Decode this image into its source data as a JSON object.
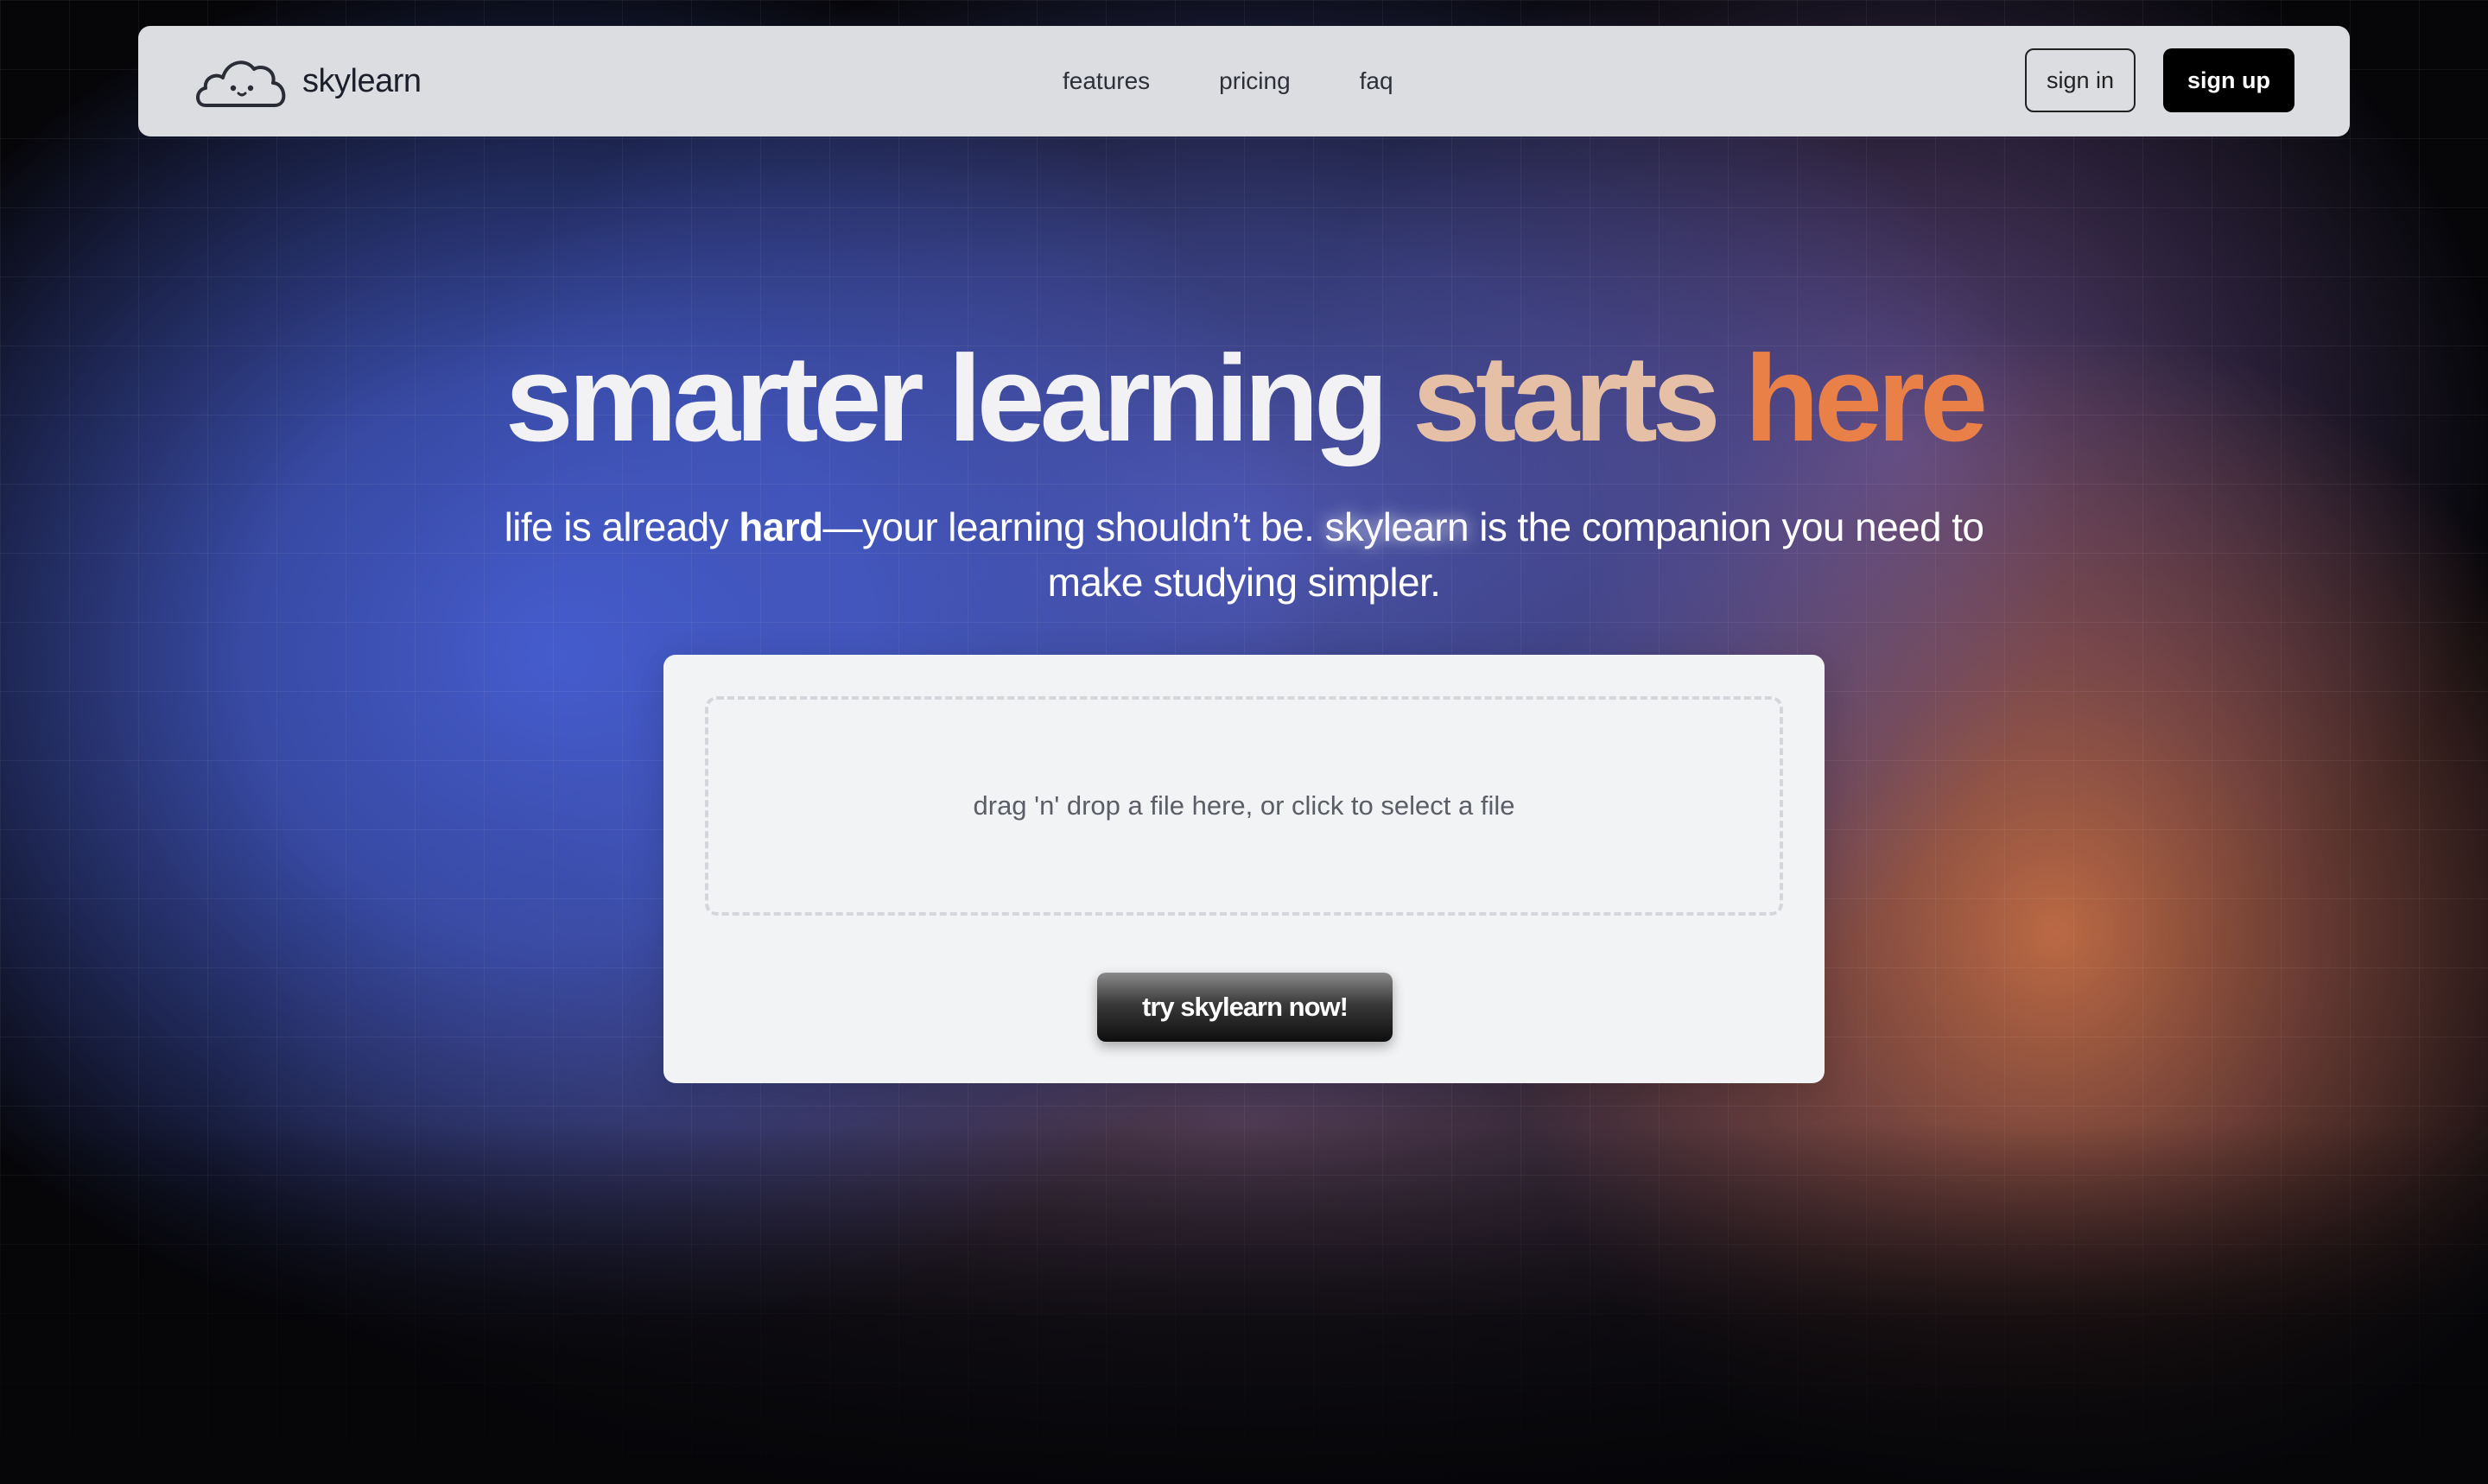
{
  "brand": {
    "name": "skylearn",
    "logo_icon": "cloud-face-icon"
  },
  "nav": {
    "links": [
      {
        "label": "features"
      },
      {
        "label": "pricing"
      },
      {
        "label": "faq"
      }
    ],
    "sign_in_label": "sign in",
    "sign_up_label": "sign up"
  },
  "hero": {
    "title_part1": "smarter learning ",
    "title_part2": "starts ",
    "title_part3": "here",
    "subtitle_part1": "life is already ",
    "subtitle_bold": "hard",
    "subtitle_part2": "—your learning shouldn’t be. ",
    "subtitle_highlight": "skylearn",
    "subtitle_part3": " is the companion you need to make studying simpler."
  },
  "upload": {
    "dropzone_text": "drag 'n' drop a file here, or click to select a file",
    "cta_label": "try skylearn now!"
  },
  "colors": {
    "nav_bg": "#dcdde1",
    "title_accent_light": "#e6c0a6",
    "title_accent_orange": "#e98048",
    "glow_blue": "#4860d6",
    "glow_orange": "#c46e46"
  }
}
